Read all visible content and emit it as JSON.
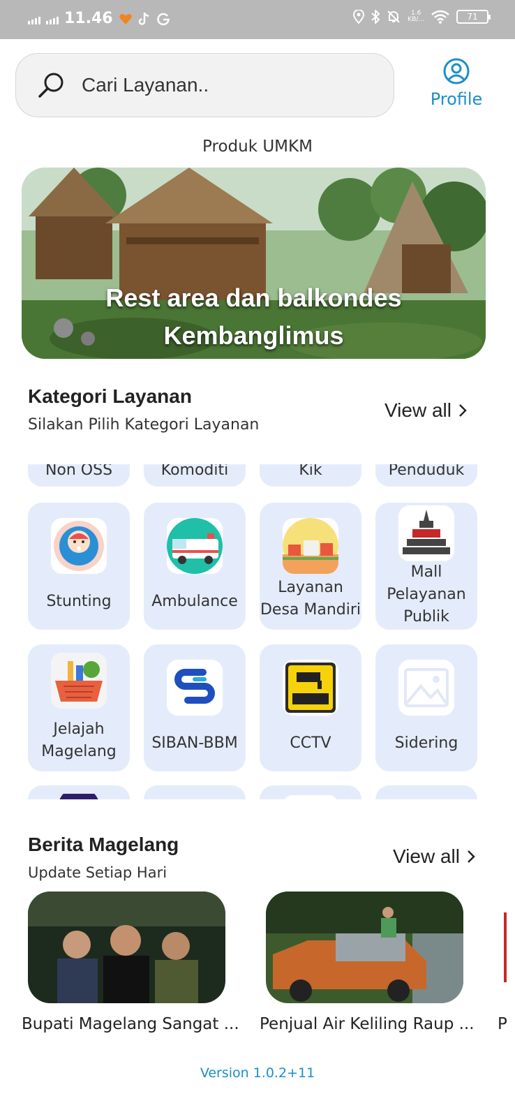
{
  "status_bar": {
    "time": "11.46",
    "net_speed_top": "1.6",
    "net_speed_bottom": "KB/...",
    "battery": "71",
    "icons": [
      "signal-icon",
      "signal-icon",
      "heart-icon",
      "tiktok-icon",
      "g-icon",
      "location-icon",
      "bluetooth-icon",
      "mute-icon",
      "wifi-icon",
      "battery-icon"
    ]
  },
  "search": {
    "placeholder": "Cari Layanan.."
  },
  "profile": {
    "label": "Profile"
  },
  "umkm": {
    "section_title": "Produk UMKM",
    "banner_caption_line1": "Rest area dan balkondes",
    "banner_caption_line2": "Kembanglimus"
  },
  "kategori": {
    "title": "Kategori Layanan",
    "subtitle": "Silakan Pilih Kategori Layanan",
    "view_all": "View all",
    "partial_top_labels": [
      "Non OSS",
      "Komoditi",
      "Kik",
      "Penduduk"
    ],
    "row1": [
      {
        "label": "Stunting",
        "icon": "baby-icon"
      },
      {
        "label": "Ambulance",
        "icon": "ambulance-icon"
      },
      {
        "label": "Layanan Desa Mandiri",
        "icon": "village-icon"
      },
      {
        "label": "Mall Pelayanan Publik",
        "icon": "temple-icon"
      }
    ],
    "row2": [
      {
        "label": "Jelajah Magelang",
        "icon": "basket-icon"
      },
      {
        "label": "SIBAN-BBM",
        "icon": "siban-logo-icon"
      },
      {
        "label": "CCTV",
        "icon": "cctv-icon"
      },
      {
        "label": "Sidering",
        "icon": "image-placeholder-icon"
      }
    ]
  },
  "berita": {
    "title": "Berita Magelang",
    "subtitle": "Update Setiap Hari",
    "view_all": "View all",
    "items": [
      {
        "title": "Bupati Magelang Sangat ..."
      },
      {
        "title": "Penjual Air Keliling Raup ..."
      },
      {
        "title": "P"
      }
    ]
  },
  "footer": {
    "version": "Version 1.0.2+11"
  }
}
